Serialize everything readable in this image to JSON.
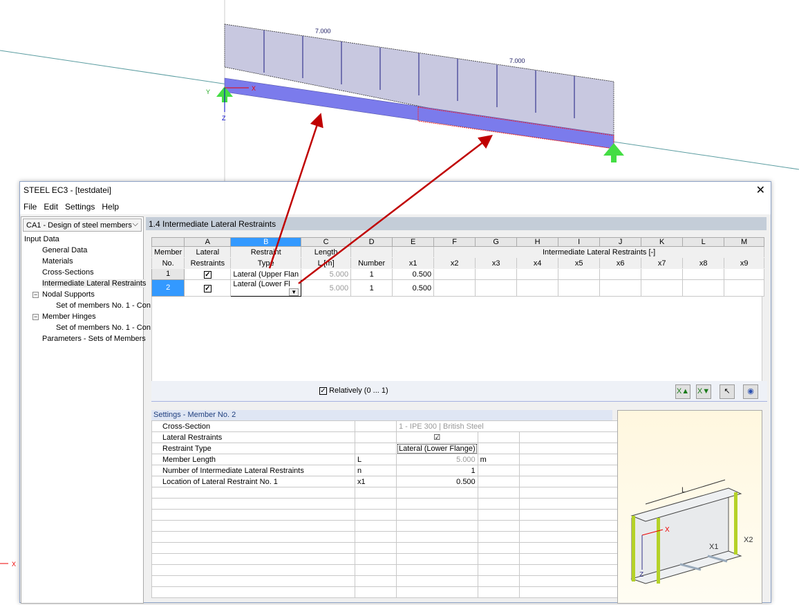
{
  "viewport": {
    "load_labels": [
      "7.000",
      "7.000"
    ],
    "axes": {
      "x": "X",
      "y": "Y",
      "z": "Z"
    },
    "colors": {
      "beam": "#7b7bec",
      "load": "#c8c8e0",
      "support": "#44dd44",
      "arrow": "#c00000",
      "selection": "#ff2020"
    }
  },
  "window": {
    "title": "STEEL EC3 - [testdatei]",
    "close": "✕"
  },
  "menu": [
    "File",
    "Edit",
    "Settings",
    "Help"
  ],
  "nav": {
    "case": "CA1 - Design of steel members",
    "tree": [
      {
        "label": "Input Data",
        "level": 0
      },
      {
        "label": "General Data",
        "level": 1
      },
      {
        "label": "Materials",
        "level": 1
      },
      {
        "label": "Cross-Sections",
        "level": 1
      },
      {
        "label": "Intermediate Lateral Restraints",
        "level": 1,
        "selected": true
      },
      {
        "label": "Nodal Supports",
        "level": 1,
        "expander": "−"
      },
      {
        "label": "Set of members No. 1 - Con",
        "level": 2
      },
      {
        "label": "Member Hinges",
        "level": 1,
        "expander": "−"
      },
      {
        "label": "Set of members No. 1 - Con",
        "level": 2
      },
      {
        "label": "Parameters - Sets of Members",
        "level": 1
      }
    ]
  },
  "section_title": "1.4 Intermediate Lateral Restraints",
  "grid": {
    "letters": [
      "A",
      "B",
      "C",
      "D",
      "E",
      "F",
      "G",
      "H",
      "I",
      "J",
      "K",
      "L",
      "M"
    ],
    "member_header": [
      "Member",
      "No."
    ],
    "headers": {
      "a": [
        "Lateral",
        "Restraints"
      ],
      "b": [
        "Restraint",
        "Type"
      ],
      "c": [
        "Length",
        "L [m]"
      ],
      "d": "Number",
      "group": "Intermediate Lateral Restraints [-]",
      "x": [
        "x1",
        "x2",
        "x3",
        "x4",
        "x5",
        "x6",
        "x7",
        "x8",
        "x9"
      ]
    },
    "rows": [
      {
        "no": "1",
        "lateral": true,
        "type": "Lateral (Upper Flan",
        "length": "5.000",
        "number": "1",
        "x1": "0.500"
      },
      {
        "no": "2",
        "lateral": true,
        "type": "Lateral (Lower Fl",
        "length": "5.000",
        "number": "1",
        "x1": "0.500",
        "selected": true
      }
    ],
    "relatively_label": "Relatively (0 ... 1)",
    "relatively": true,
    "toolbar": [
      "excel-export-icon",
      "excel-import-icon",
      "pick-icon",
      "view-icon"
    ]
  },
  "settings": {
    "title": "Settings - Member No. 2",
    "rows": [
      {
        "label": "Cross-Section",
        "symbol": "",
        "value": "1 - IPE 300 | British Steel",
        "unit": ""
      },
      {
        "label": "Lateral Restraints",
        "symbol": "",
        "value": "☑",
        "unit": ""
      },
      {
        "label": "Restraint Type",
        "symbol": "",
        "value": "Lateral (Lower Flange)",
        "unit": ""
      },
      {
        "label": "Member Length",
        "symbol": "L",
        "value": "5.000",
        "unit": "m"
      },
      {
        "label": "Number of Intermediate Lateral Restraints",
        "symbol": "n",
        "value": "1",
        "unit": ""
      },
      {
        "label": "Location of Lateral Restraint No. 1",
        "symbol": "x1",
        "value": "0.500",
        "unit": ""
      }
    ]
  },
  "diagram": {
    "labels": {
      "L": "L",
      "x": "X",
      "z": "Z",
      "x1": "X1",
      "x2": "X2"
    }
  }
}
